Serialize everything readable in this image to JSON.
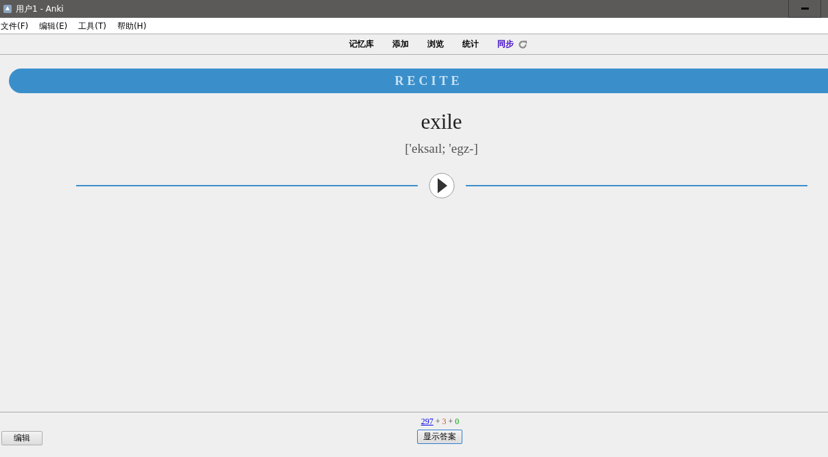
{
  "window": {
    "title": "用户1 - Anki"
  },
  "menu": [
    "文件(F)",
    "编辑(E)",
    "工具(T)",
    "帮助(H)"
  ],
  "toolbar": [
    {
      "label": "记忆库",
      "kind": "plain"
    },
    {
      "label": "添加",
      "kind": "plain"
    },
    {
      "label": "浏览",
      "kind": "plain"
    },
    {
      "label": "统计",
      "kind": "plain"
    },
    {
      "label": "同步",
      "kind": "sync"
    }
  ],
  "card": {
    "banner": "RECITE",
    "word": "exile",
    "phonetic": "['eksaɪl; 'egz-]"
  },
  "counts": [
    {
      "text": "297",
      "kind": "new"
    },
    {
      "text": "+",
      "kind": "sep"
    },
    {
      "text": "3",
      "kind": "learn"
    },
    {
      "text": "+",
      "kind": "sep"
    },
    {
      "text": "0",
      "kind": "review"
    }
  ],
  "buttons": {
    "edit": "编辑",
    "show_answer": "显示答案"
  }
}
